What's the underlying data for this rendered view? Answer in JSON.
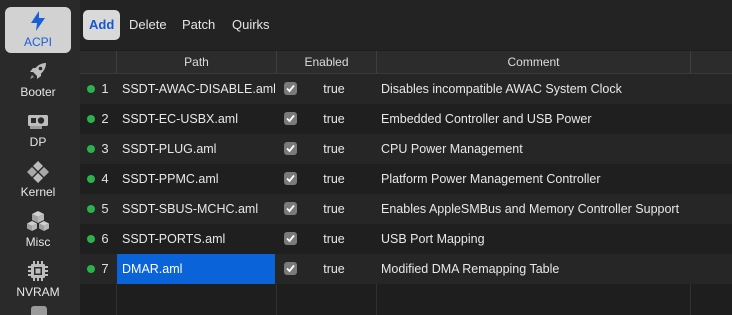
{
  "sidebar": {
    "items": [
      {
        "label": "ACPI",
        "icon": "bolt-icon",
        "active": true
      },
      {
        "label": "Booter",
        "icon": "rocket-icon",
        "active": false
      },
      {
        "label": "DP",
        "icon": "gpu-card-icon",
        "active": false
      },
      {
        "label": "Kernel",
        "icon": "puzzle-icon",
        "active": false
      },
      {
        "label": "Misc",
        "icon": "cubes-icon",
        "active": false
      },
      {
        "label": "NVRAM",
        "icon": "chip-icon",
        "active": false
      }
    ]
  },
  "toolbar": {
    "tabs": [
      {
        "label": "Add",
        "active": true
      },
      {
        "label": "Delete",
        "active": false
      },
      {
        "label": "Patch",
        "active": false
      },
      {
        "label": "Quirks",
        "active": false
      }
    ]
  },
  "table": {
    "headers": {
      "path": "Path",
      "enabled": "Enabled",
      "comment": "Comment"
    },
    "rows": [
      {
        "index": "1",
        "path": "SSDT-AWAC-DISABLE.aml",
        "checked": true,
        "enabled": "true",
        "comment": "Disables incompatible AWAC System Clock",
        "selected": false
      },
      {
        "index": "2",
        "path": "SSDT-EC-USBX.aml",
        "checked": true,
        "enabled": "true",
        "comment": "Embedded Controller and USB Power",
        "selected": false
      },
      {
        "index": "3",
        "path": "SSDT-PLUG.aml",
        "checked": true,
        "enabled": "true",
        "comment": "CPU Power Management",
        "selected": false
      },
      {
        "index": "4",
        "path": "SSDT-PPMC.aml",
        "checked": true,
        "enabled": "true",
        "comment": "Platform Power Management Controller",
        "selected": false
      },
      {
        "index": "5",
        "path": "SSDT-SBUS-MCHC.aml",
        "checked": true,
        "enabled": "true",
        "comment": "Enables AppleSMBus and Memory Controller Support",
        "selected": false
      },
      {
        "index": "6",
        "path": "SSDT-PORTS.aml",
        "checked": true,
        "enabled": "true",
        "comment": "USB Port Mapping",
        "selected": false
      },
      {
        "index": "7",
        "path": "DMAR.aml",
        "checked": true,
        "enabled": "true",
        "comment": "Modified DMA Remapping Table",
        "selected": true
      }
    ]
  },
  "colors": {
    "accent": "#0a63d8",
    "active_tab_text": "#1a55d0",
    "status_dot": "#2bb24c",
    "background": "#1e1e1e"
  }
}
